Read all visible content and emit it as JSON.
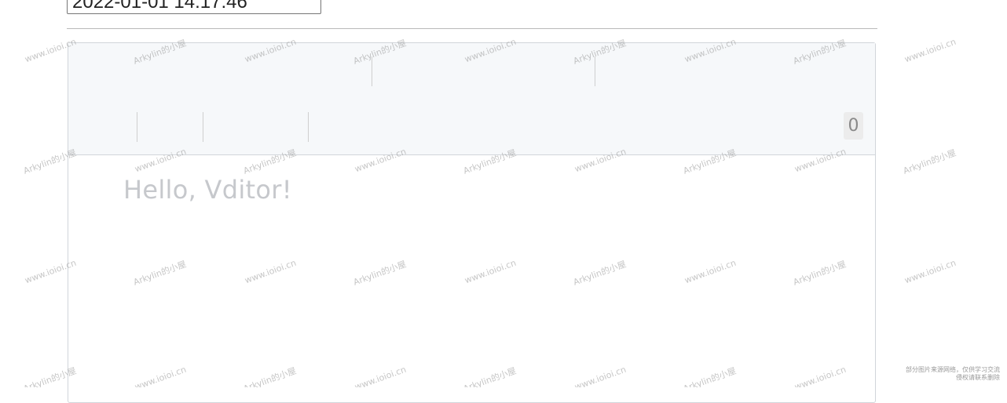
{
  "datetime_input": {
    "value": "2022-01-01 14:17:46"
  },
  "toolbar": {
    "counter": "0"
  },
  "editor": {
    "placeholder": "Hello, Vditor!"
  },
  "watermarks": {
    "site": "www.ioioi.cn",
    "owner": "Arkylin的小屋"
  },
  "corner_note": {
    "line1": "部分图片来源网络，仅供学习交流",
    "line2": "侵权请联系删除"
  }
}
